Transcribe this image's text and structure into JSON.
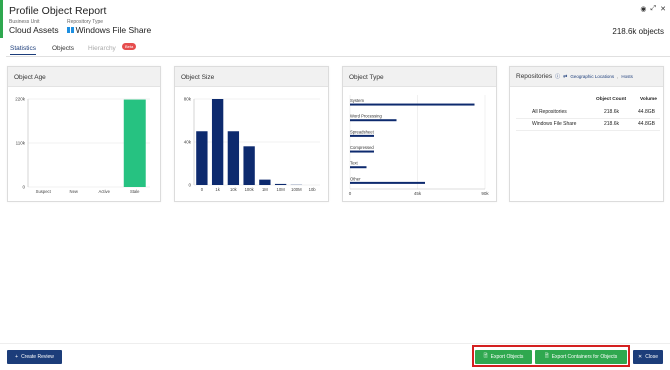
{
  "header": {
    "title": "Profile Object Report",
    "business_unit_label": "Business Unit",
    "business_unit_value": "Cloud Assets",
    "repo_type_label": "Repository Type",
    "repo_type_value": "Windows File Share",
    "object_count": "218.6k objects",
    "window_icons": [
      "eye-icon",
      "expand-icon",
      "close-icon"
    ]
  },
  "tabs": [
    {
      "label": "Statistics",
      "state": "active"
    },
    {
      "label": "Objects",
      "state": "normal"
    },
    {
      "label": "Hierarchy",
      "state": "disabled",
      "badge": "Beta"
    }
  ],
  "cards": {
    "object_age": "Object Age",
    "object_size": "Object Size",
    "object_type": "Object Type",
    "repositories": "Repositories",
    "repo_links": [
      "Geographic Locations",
      "Hosts"
    ]
  },
  "repositories_table": {
    "headers": [
      "Object Count",
      "Volume"
    ],
    "rows": [
      {
        "name": "All Repositories",
        "count": "218.6k",
        "volume": "44.8GB"
      },
      {
        "name": "Windows File Share",
        "count": "218.6k",
        "volume": "44.8GB",
        "icon": "windows-icon"
      }
    ]
  },
  "chart_data": [
    {
      "type": "bar",
      "title": "Object Age",
      "categories": [
        "Suspect",
        "New",
        "Active",
        "Stale"
      ],
      "values": [
        0,
        0,
        0,
        218600
      ],
      "y_ticks": [
        "0",
        "110k",
        "220k"
      ],
      "ylim": [
        0,
        220000
      ],
      "color": "#26c281",
      "grid": true
    },
    {
      "type": "bar",
      "title": "Object Size",
      "categories": [
        "0",
        "1k",
        "10k",
        "100k",
        "1M",
        "10M",
        "100M",
        "10b"
      ],
      "values": [
        50000,
        80000,
        50000,
        36000,
        5000,
        1000,
        200,
        0
      ],
      "y_ticks": [
        "0",
        "40k",
        "80k"
      ],
      "ylim": [
        0,
        80000
      ],
      "color": "#0d2a6e",
      "grid": true
    },
    {
      "type": "bar",
      "orientation": "horizontal",
      "title": "Object Type",
      "categories": [
        "System",
        "Word Processing",
        "Spreadsheet",
        "Compressed",
        "Text",
        "Other"
      ],
      "values": [
        83000,
        31000,
        16000,
        16000,
        11000,
        50000
      ],
      "x_ticks": [
        "0",
        "45k",
        "90k"
      ],
      "xlim": [
        0,
        90000
      ],
      "color": "#0d2a6e",
      "grid": true
    }
  ],
  "footer": {
    "create_review": "Create Review",
    "export_objects": "Export Objects",
    "export_containers": "Export Containers for Objects",
    "close": "Close"
  },
  "colors": {
    "accent": "#2fa84f",
    "navy": "#1c3d7a",
    "highlight": "#d42020"
  }
}
